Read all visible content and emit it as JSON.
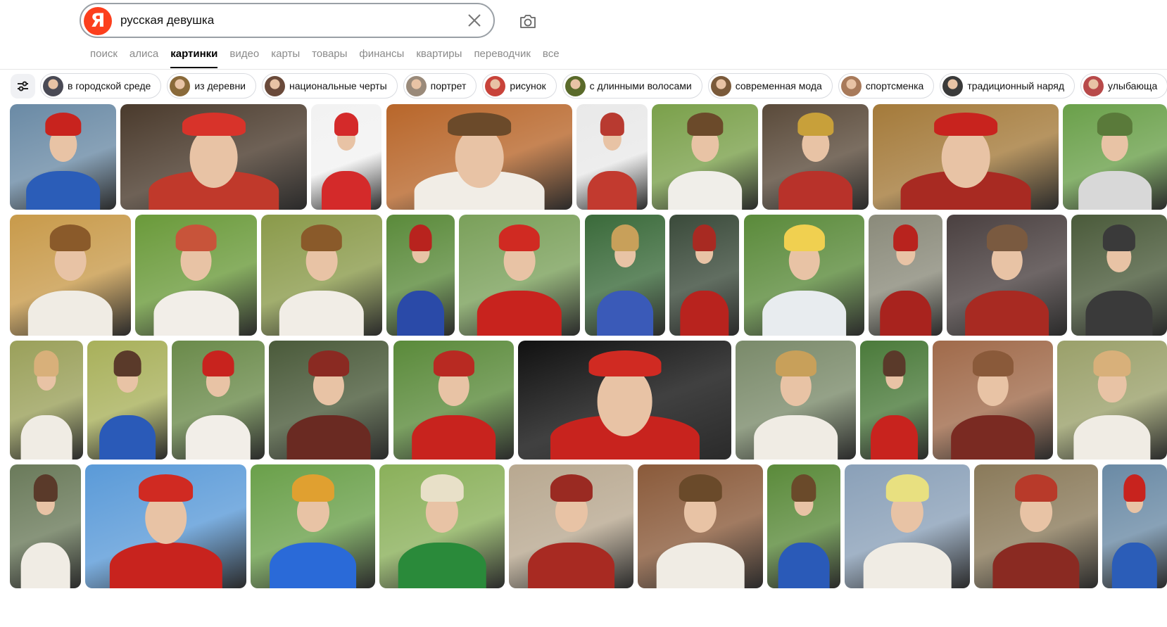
{
  "search": {
    "logo_letter": "Я",
    "query": "русская девушка"
  },
  "tabs": [
    {
      "label": "поиск",
      "active": false
    },
    {
      "label": "алиса",
      "active": false
    },
    {
      "label": "картинки",
      "active": true
    },
    {
      "label": "видео",
      "active": false
    },
    {
      "label": "карты",
      "active": false
    },
    {
      "label": "товары",
      "active": false
    },
    {
      "label": "финансы",
      "active": false
    },
    {
      "label": "квартиры",
      "active": false
    },
    {
      "label": "переводчик",
      "active": false
    },
    {
      "label": "все",
      "active": false
    }
  ],
  "chips": [
    {
      "label": "в городской среде",
      "color": "#4a4a55"
    },
    {
      "label": "из деревни",
      "color": "#8a6a3a"
    },
    {
      "label": "национальные черты",
      "color": "#6a4a3a"
    },
    {
      "label": "портрет",
      "color": "#9a8a7a"
    },
    {
      "label": "рисунок",
      "color": "#c8433a"
    },
    {
      "label": "с длинными волосами",
      "color": "#5a6a2a"
    },
    {
      "label": "современная мода",
      "color": "#7a5a3a"
    },
    {
      "label": "спортсменка",
      "color": "#a87a5a"
    },
    {
      "label": "традиционный наряд",
      "color": "#3a3a3a"
    },
    {
      "label": "улыбающа",
      "color": "#b84a4a"
    }
  ],
  "images": [
    {
      "bg": "#6a8aa5",
      "dress": "#2b5db8",
      "hd": "#c8231e"
    },
    {
      "bg": "#4a3a2c",
      "dress": "#c0392b",
      "hd": "#d8332a"
    },
    {
      "bg": "#f2f2f2",
      "dress": "#d42a2a",
      "hd": "#d42a2a"
    },
    {
      "bg": "#b8662a",
      "dress": "#f1ede6",
      "hd": "#6b4a2a"
    },
    {
      "bg": "#e9e9e9",
      "dress": "#c23a2f",
      "hd": "#b83a30"
    },
    {
      "bg": "#7aa04a",
      "dress": "#f0eee9",
      "hd": "#6b4a2a"
    },
    {
      "bg": "#5a4a3a",
      "dress": "#b8322a",
      "hd": "#c8a03a"
    },
    {
      "bg": "#a47a3a",
      "dress": "#a82a22",
      "hd": "#c8231e"
    },
    {
      "bg": "#6aa04a",
      "dress": "#d8d8d8",
      "hd": "#5a7a3a"
    },
    {
      "bg": "#c89a4a",
      "dress": "#f0ece4",
      "hd": "#8a5a2a"
    },
    {
      "bg": "#6a9a3a",
      "dress": "#f2eee8",
      "hd": "#c8543a"
    },
    {
      "bg": "#8a9a4a",
      "dress": "#f1ede6",
      "hd": "#8a5a2a"
    },
    {
      "bg": "#5a8a3a",
      "dress": "#2a4aa8",
      "hd": "#b8231e"
    },
    {
      "bg": "#7aa05a",
      "dress": "#c8231e",
      "hd": "#d02a22"
    },
    {
      "bg": "#3a6a3a",
      "dress": "#3a5ab8",
      "hd": "#c8a05a"
    },
    {
      "bg": "#3a4a3a",
      "dress": "#b8231e",
      "hd": "#a82a22"
    },
    {
      "bg": "#5a8a3a",
      "dress": "#e8ecef",
      "hd": "#f0d050"
    },
    {
      "bg": "#8a8a7a",
      "dress": "#a8231e",
      "hd": "#b8231e"
    },
    {
      "bg": "#4a4040",
      "dress": "#a82a22",
      "hd": "#7a5a40"
    },
    {
      "bg": "#4a5a3a",
      "dress": "#3a3a3a",
      "hd": "#3a3a3a"
    },
    {
      "bg": "#9aa05a",
      "dress": "#f0ece4",
      "hd": "#d8b07a"
    },
    {
      "bg": "#a8b05a",
      "dress": "#2a5ab8",
      "hd": "#5a3a2a"
    },
    {
      "bg": "#6a8a4a",
      "dress": "#f2eee8",
      "hd": "#c8231e"
    },
    {
      "bg": "#4a5a3a",
      "dress": "#6a2a22",
      "hd": "#8a2a22"
    },
    {
      "bg": "#5a8a3a",
      "dress": "#c8231e",
      "hd": "#b82a22"
    },
    {
      "bg": "#111111",
      "dress": "#c8231e",
      "hd": "#d02a22"
    },
    {
      "bg": "#7a8a6a",
      "dress": "#f0ece4",
      "hd": "#c8a05a"
    },
    {
      "bg": "#4a7a3a",
      "dress": "#c8231e",
      "hd": "#5a3a2a"
    },
    {
      "bg": "#a06a4a",
      "dress": "#7a2a22",
      "hd": "#8a5a3a"
    },
    {
      "bg": "#9aa06a",
      "dress": "#f0ece4",
      "hd": "#d8b07a"
    },
    {
      "bg": "#6a7a5a",
      "dress": "#f0ece4",
      "hd": "#5a3a2a"
    },
    {
      "bg": "#5a9ad8",
      "dress": "#c8231e",
      "hd": "#d02a22"
    },
    {
      "bg": "#6aa04a",
      "dress": "#2a6ad8",
      "hd": "#e0a030"
    },
    {
      "bg": "#8ab05a",
      "dress": "#2a8a3a",
      "hd": "#e8e0c8"
    },
    {
      "bg": "#b8a890",
      "dress": "#a82a22",
      "hd": "#9a2a22"
    },
    {
      "bg": "#8a5a3a",
      "dress": "#f0ece4",
      "hd": "#6a4a2a"
    },
    {
      "bg": "#5a8a3a",
      "dress": "#2a5ab8",
      "hd": "#6a4a2a"
    },
    {
      "bg": "#8aa0b8",
      "dress": "#f0ece4",
      "hd": "#e8e080"
    },
    {
      "bg": "#8a7a5a",
      "dress": "#8a2a22",
      "hd": "#b83a2a"
    }
  ]
}
